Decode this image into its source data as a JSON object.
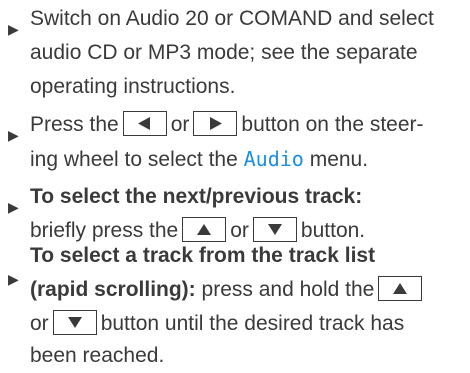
{
  "steps": [
    {
      "lines": [
        "Switch on Audio 20 or COMAND and select",
        "audio CD or MP3 mode; see the separate",
        "operating instructions."
      ]
    },
    {
      "line1": {
        "a": "Press the",
        "b": "or",
        "c": "button on the steer-"
      },
      "line2": {
        "a": "ing wheel to select the",
        "menu": "Audio",
        "b": "menu."
      },
      "buttons": [
        "left-arrow",
        "right-arrow"
      ]
    },
    {
      "bold": "To select the next/previous track:",
      "line2": {
        "a": "briefly press the",
        "b": "or",
        "c": "button."
      },
      "buttons": [
        "up-arrow",
        "down-arrow"
      ]
    },
    {
      "bold1": "To select a track from the track list",
      "bold2": "(rapid scrolling):",
      "line2_rest": "press and hold the",
      "line3": {
        "a": "or",
        "b": "button until the desired track has"
      },
      "line4": "been reached.",
      "buttons": [
        "up-arrow",
        "down-arrow"
      ]
    }
  ],
  "colors": {
    "text": "#3a3a3a",
    "menu_word": "#1d8fe0"
  }
}
